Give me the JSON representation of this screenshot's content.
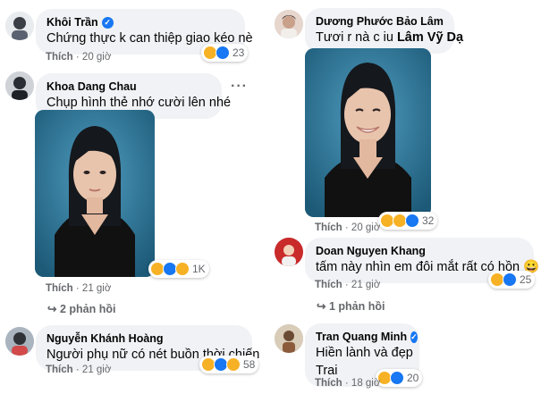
{
  "left": {
    "c1": {
      "author": "Khôi Trần",
      "verified": true,
      "text": "Chứng thực k can thiệp giao kéo nè",
      "like": "Thích",
      "time": "20 giờ",
      "count": "23"
    },
    "c2": {
      "author": "Khoa Dang Chau",
      "text": "Chụp hình thẻ nhớ cười lên nhé",
      "like": "Thích",
      "time": "21 giờ",
      "count": "1K",
      "replies": "2 phản hồi"
    },
    "c3": {
      "author": "Nguyễn Khánh Hoàng",
      "text": "Người phụ nữ có nét buồn thời chiến",
      "like": "Thích",
      "time": "21 giờ",
      "count": "58"
    }
  },
  "right": {
    "c1": {
      "author": "Dương Phước Bảo Lâm",
      "text": "Tươi r nà c iu ",
      "mention": "Lâm Vỹ Dạ",
      "like": "Thích",
      "time": "20 giờ",
      "count": "32"
    },
    "c2": {
      "author": "Doan Nguyen Khang",
      "text": "tấm này nhìn em đôi mắt rất có hồn 😀",
      "like": "Thích",
      "time": "21 giờ",
      "count": "25",
      "replies": "1 phản hồi"
    },
    "c3": {
      "author": "Tran Quang Minh",
      "verified": true,
      "text_line1": "Hiền lành và đẹp",
      "text_line2": "Trai",
      "like": "Thích",
      "time": "18 giờ",
      "count": "20"
    }
  },
  "separator": "·",
  "more_glyph": "···",
  "verified_glyph": "✓",
  "reply_arrow": "↪",
  "icons": [
    "avatar",
    "haha-reaction",
    "like-reaction",
    "sad-reaction",
    "love-reaction",
    "care-reaction",
    "verified-badge",
    "more-options-icon",
    "reply-arrow-icon",
    "id-photo"
  ]
}
